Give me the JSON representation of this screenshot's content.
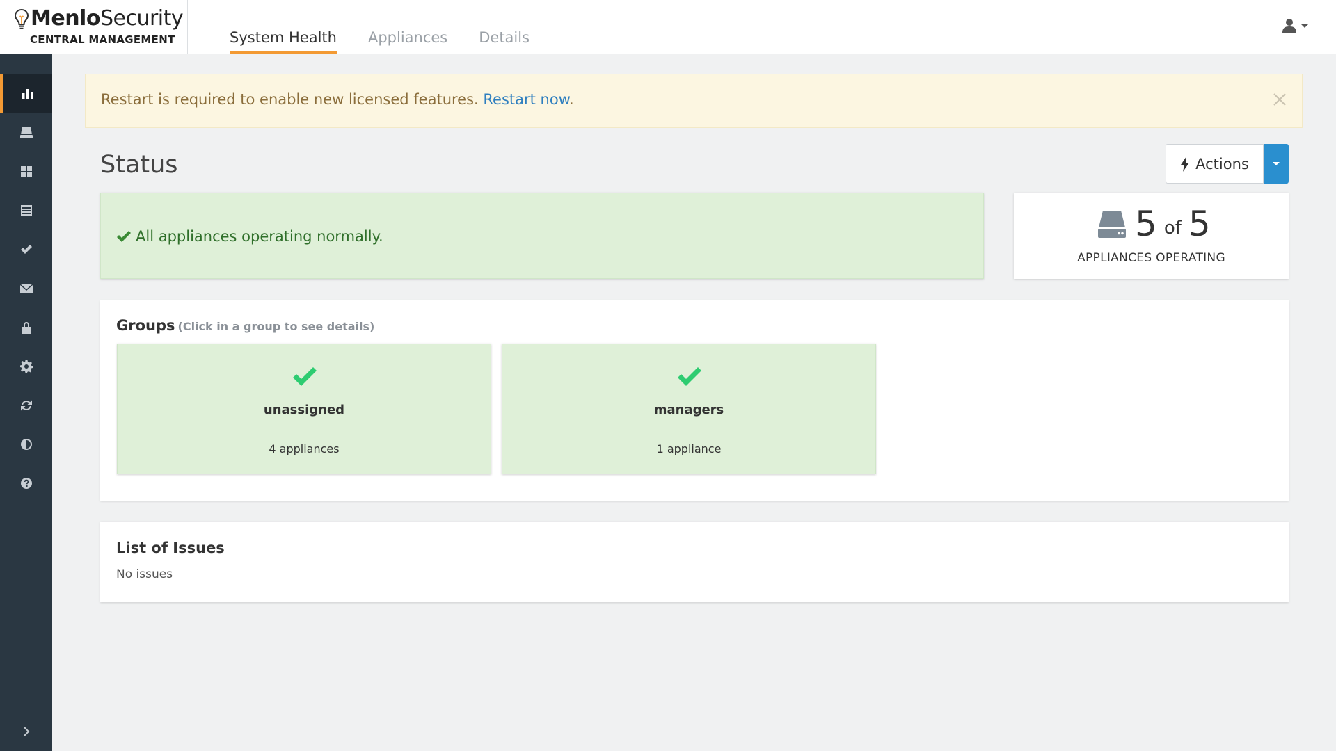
{
  "header": {
    "brand_light": "Menlo",
    "brand_regular": "Security",
    "brand_sub": "CENTRAL MANAGEMENT",
    "tabs": [
      {
        "label": "System Health",
        "active": true
      },
      {
        "label": "Appliances",
        "active": false
      },
      {
        "label": "Details",
        "active": false
      }
    ],
    "user_icon": "user-icon"
  },
  "sidebar": {
    "items": [
      {
        "name": "bar-chart-icon",
        "active": true
      },
      {
        "name": "appliance-icon",
        "active": false
      },
      {
        "name": "grid-icon",
        "active": false
      },
      {
        "name": "list-icon",
        "active": false
      },
      {
        "name": "check-icon",
        "active": false
      },
      {
        "name": "envelope-icon",
        "active": false
      },
      {
        "name": "lock-icon",
        "active": false
      },
      {
        "name": "gear-icon",
        "active": false
      },
      {
        "name": "refresh-icon",
        "active": false
      },
      {
        "name": "contrast-icon",
        "active": false
      },
      {
        "name": "help-icon",
        "active": false
      }
    ],
    "expand_icon": "chevron-right-icon"
  },
  "banner": {
    "text": "Restart is required to enable new licensed features. ",
    "link": "Restart now",
    "suffix": "."
  },
  "status": {
    "title": "Status",
    "actions_label": "Actions",
    "message": "All appliances operating normally.",
    "operating": "5",
    "of": "of",
    "total": "5",
    "operating_label": "APPLIANCES OPERATING"
  },
  "groups": {
    "title": "Groups",
    "hint": "(Click in a group to see details)",
    "items": [
      {
        "name": "unassigned",
        "count": "4 appliances"
      },
      {
        "name": "managers",
        "count": "1 appliance"
      }
    ]
  },
  "issues": {
    "title": "List of Issues",
    "empty": "No issues"
  },
  "colors": {
    "accent": "#f39a34",
    "sidebar": "#2a3742",
    "success_bg": "#dff0d8",
    "success_check": "#2ecc71",
    "link": "#2f7fbf",
    "primary_button": "#2a8fcf",
    "banner_bg": "#fcf6e1"
  }
}
